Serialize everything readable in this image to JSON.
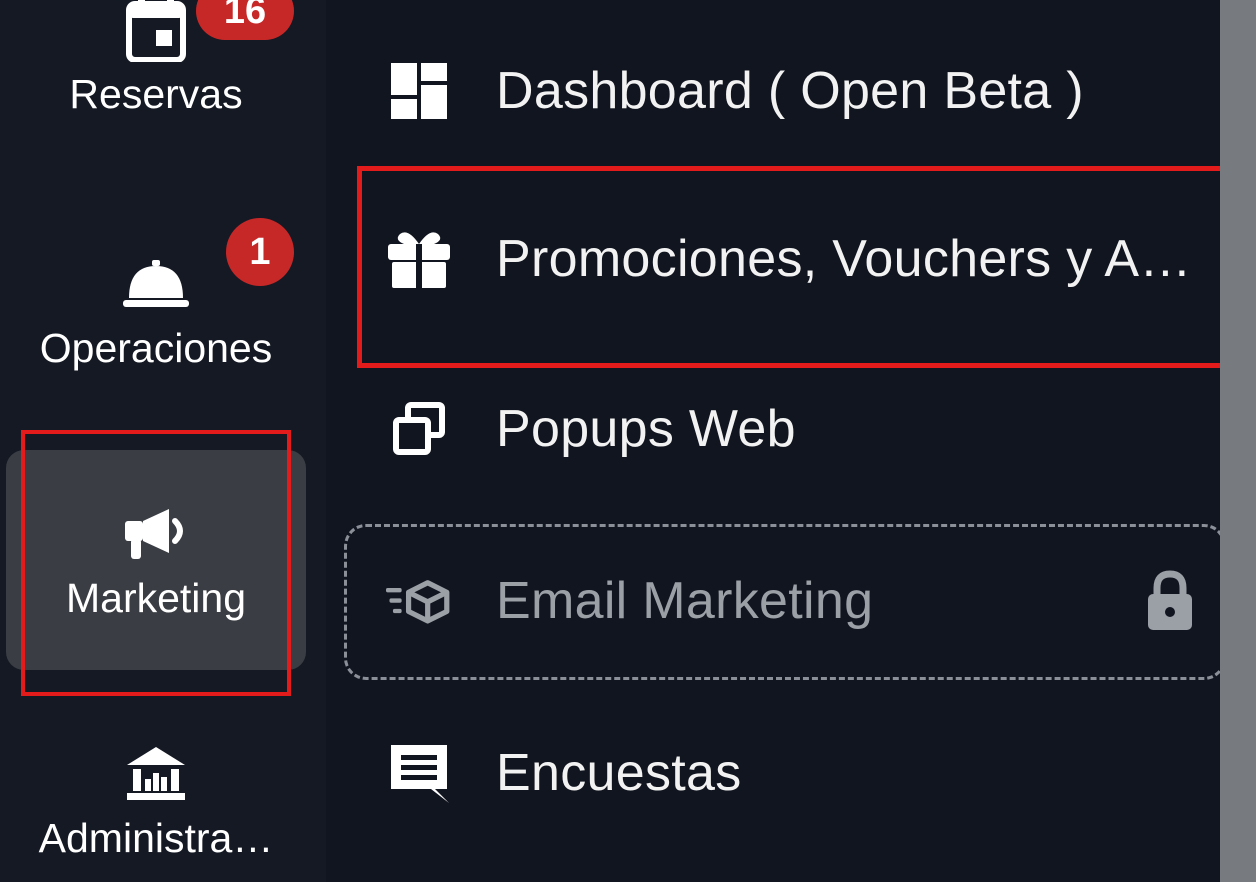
{
  "rail": {
    "items": [
      {
        "label": "Reservas",
        "icon": "calendar-icon",
        "badge": "16"
      },
      {
        "label": "Operaciones",
        "icon": "service-bell-icon",
        "badge": "1"
      },
      {
        "label": "Marketing",
        "icon": "megaphone-icon",
        "selected": true
      },
      {
        "label": "Administra…",
        "icon": "bank-icon"
      }
    ]
  },
  "submenu": {
    "items": [
      {
        "label": "Dashboard ( Open Beta )",
        "icon": "dashboard-icon"
      },
      {
        "label": "Promociones, Vouchers y A…",
        "icon": "gift-icon"
      },
      {
        "label": "Popups Web",
        "icon": "popup-windows-icon"
      },
      {
        "label": "Email Marketing",
        "icon": "email-send-icon",
        "locked": true
      },
      {
        "label": "Encuestas",
        "icon": "feedback-icon"
      }
    ]
  },
  "colors": {
    "highlight": "#e31b1b",
    "badge": "#c62828",
    "rail_selected": "#3a3d43",
    "background": "#11151f"
  }
}
